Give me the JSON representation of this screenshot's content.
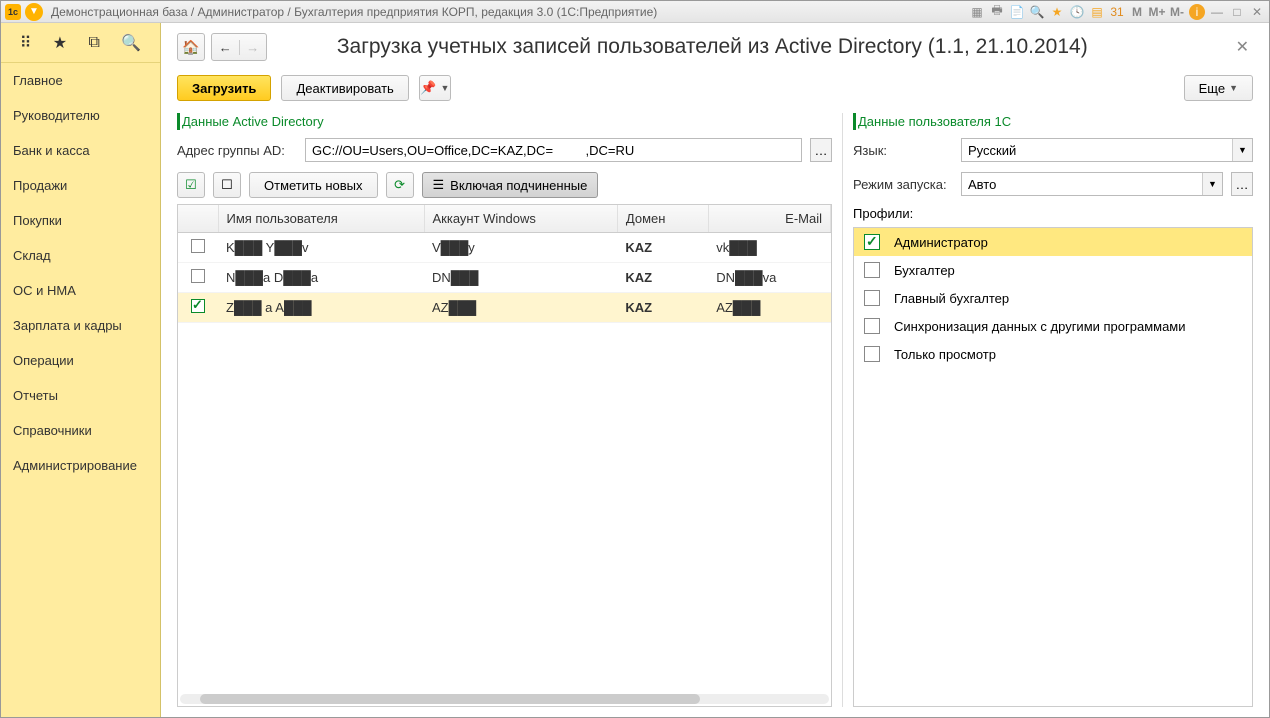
{
  "titlebar": {
    "text": "Демонстрационная база / Администратор / Бухгалтерия предприятия КОРП, редакция 3.0  (1С:Предприятие)",
    "m": "M",
    "mplus": "M+",
    "mminus": "M-"
  },
  "sidebar": {
    "items": [
      {
        "label": "Главное"
      },
      {
        "label": "Руководителю"
      },
      {
        "label": "Банк и касса"
      },
      {
        "label": "Продажи"
      },
      {
        "label": "Покупки"
      },
      {
        "label": "Склад"
      },
      {
        "label": "ОС и НМА"
      },
      {
        "label": "Зарплата и кадры"
      },
      {
        "label": "Операции"
      },
      {
        "label": "Отчеты"
      },
      {
        "label": "Справочники"
      },
      {
        "label": "Администрирование"
      }
    ]
  },
  "page": {
    "title": "Загрузка учетных записей пользователей из Active Directory (1.1, 21.10.2014)",
    "load": "Загрузить",
    "deactivate": "Деактивировать",
    "more": "Еще"
  },
  "ad": {
    "section": "Данные Active Directory",
    "address_label": "Адрес группы AD:",
    "address_value": "GC://OU=Users,OU=Office,DC=KAZ,DC=         ,DC=RU",
    "mark_new": "Отметить новых",
    "include_sub": "Включая подчиненные",
    "columns": {
      "user": "Имя пользователя",
      "account": "Аккаунт Windows",
      "domain": "Домен",
      "email": "E-Mail"
    },
    "rows": [
      {
        "checked": false,
        "user": "K███ Y███v",
        "account": "V███y",
        "domain": "KAZ",
        "email": "vk███"
      },
      {
        "checked": false,
        "user": "N███a D███a",
        "account": "DN███",
        "domain": "KAZ",
        "email": "DN███va"
      },
      {
        "checked": true,
        "user": "Z███ a A███",
        "account": "AZ███",
        "domain": "KAZ",
        "email": "AZ███"
      }
    ]
  },
  "user1c": {
    "section": "Данные пользователя 1С",
    "lang_label": "Язык:",
    "lang_value": "Русский",
    "mode_label": "Режим запуска:",
    "mode_value": "Авто",
    "profiles_label": "Профили:",
    "profiles": [
      {
        "checked": true,
        "selected": true,
        "label": "Администратор"
      },
      {
        "checked": false,
        "selected": false,
        "label": "Бухгалтер"
      },
      {
        "checked": false,
        "selected": false,
        "label": "Главный бухгалтер"
      },
      {
        "checked": false,
        "selected": false,
        "label": "Синхронизация данных с другими программами"
      },
      {
        "checked": false,
        "selected": false,
        "label": "Только просмотр"
      }
    ]
  }
}
